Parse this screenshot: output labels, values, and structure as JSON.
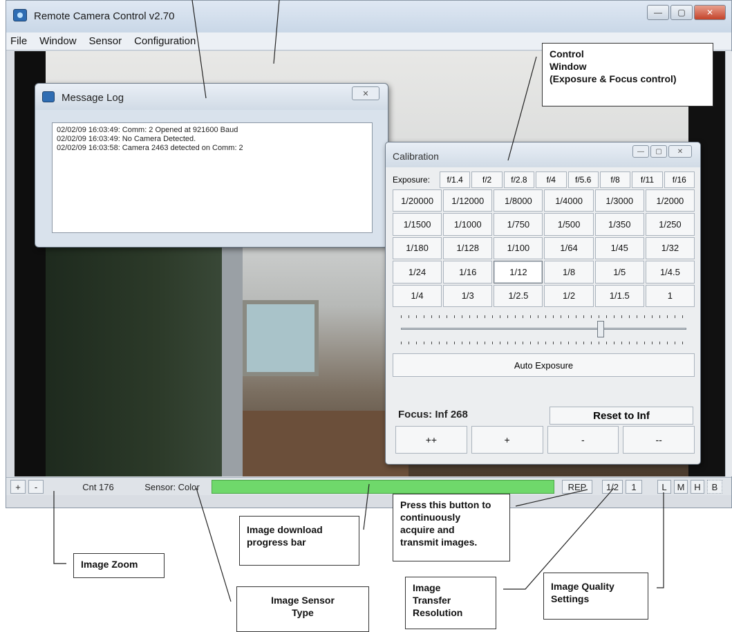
{
  "app": {
    "title": "Remote Camera Control v2.70",
    "minimize": "—",
    "maximize": "▢",
    "close": "✕"
  },
  "menu": [
    "File",
    "Window",
    "Sensor",
    "Configuration"
  ],
  "message_log": {
    "title": "Message Log",
    "close": "✕",
    "lines": [
      "02/02/09 16:03:49: Comm: 2 Opened at 921600 Baud",
      "02/02/09 16:03:49: No Camera Detected.",
      "02/02/09 16:03:58: Camera 2463 detected on Comm: 2"
    ]
  },
  "calibration": {
    "title": "Calibration",
    "exposure_label": "Exposure:",
    "fstops": [
      "f/1.4",
      "f/2",
      "f/2.8",
      "f/4",
      "f/5.6",
      "f/8",
      "f/11",
      "f/16"
    ],
    "shutter": [
      "1/20000",
      "1/12000",
      "1/8000",
      "1/4000",
      "1/3000",
      "1/2000",
      "1/1500",
      "1/1000",
      "1/750",
      "1/500",
      "1/350",
      "1/250",
      "1/180",
      "1/128",
      "1/100",
      "1/64",
      "1/45",
      "1/32",
      "1/24",
      "1/16",
      "1/12",
      "1/8",
      "1/5",
      "1/4.5",
      "1/4",
      "1/3",
      "1/2.5",
      "1/2",
      "1/1.5",
      "1"
    ],
    "selected_shutter": "1/12",
    "slider_level": 0.7,
    "auto_exposure": "Auto Exposure",
    "focus_label": "Focus: Inf 268",
    "reset_label": "Reset to Inf",
    "focus_buttons": [
      "++",
      "+",
      "-",
      "--"
    ]
  },
  "statusbar": {
    "zoom_in": "+",
    "zoom_out": "-",
    "cnt": "Cnt 176",
    "sensor": "Sensor: Color",
    "progress": 1.0,
    "rep": "REP",
    "res_half": "1/2",
    "res_one": "1",
    "quality_l": "L",
    "quality_m": "M",
    "quality_h": "H",
    "quality_b": "B"
  },
  "annotations": {
    "control": [
      "Control",
      "Window",
      "(Exposure & Focus control)"
    ],
    "press": [
      "Press this button to",
      "continuously",
      "acquire and",
      "transmit images."
    ],
    "download": [
      "Image download",
      "progress bar"
    ],
    "zoom": "Image Zoom",
    "sensor_type": [
      "Image Sensor",
      "Type"
    ],
    "transfer": [
      "Image",
      "Transfer",
      "Resolution"
    ],
    "quality": [
      "Image Quality",
      "Settings"
    ]
  }
}
